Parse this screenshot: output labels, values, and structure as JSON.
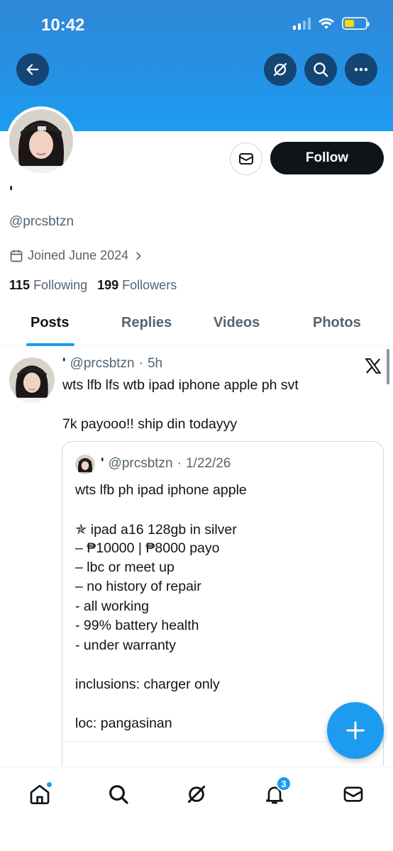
{
  "status_bar": {
    "time": "10:42"
  },
  "colors": {
    "accent": "#1d9bf0",
    "follow_bg": "#0f1419",
    "battery": "#ffd60a"
  },
  "header": {
    "back_icon": "arrow-left-icon",
    "grok_icon": "grok-icon",
    "search_icon": "search-icon",
    "more_icon": "more-icon"
  },
  "profile": {
    "display_name": "'",
    "handle": "@prcsbtzn",
    "joined": "Joined June 2024",
    "following_count": "115",
    "following_label": "Following",
    "followers_count": "199",
    "followers_label": "Followers",
    "follow_label": "Follow"
  },
  "tabs": [
    {
      "label": "Posts"
    },
    {
      "label": "Replies"
    },
    {
      "label": "Videos"
    },
    {
      "label": "Photos"
    }
  ],
  "post": {
    "name": "'",
    "handle": "@prcsbtzn",
    "sep": "·",
    "time": "5h",
    "text_line1": "wts lfb lfs wtb ipad iphone apple ph svt",
    "text_line2": "7k payooo!! ship din todayyy",
    "quote": {
      "name": "'",
      "handle": "@prcsbtzn",
      "sep": "·",
      "date": "1/22/26",
      "lines": [
        "wts lfb ph ipad iphone apple",
        "✯ ipad a16 128gb in silver",
        "– ₱10000 | ₱8000 payo",
        "– lbc or meet up",
        "– no history of repair",
        "- all working",
        "- 99% battery health",
        "- under warranty",
        "inclusions: charger only",
        "loc: pangasinan"
      ]
    }
  },
  "bottom_nav": {
    "items": [
      "home-icon",
      "search-icon",
      "grok-icon",
      "notifications-icon",
      "messages-icon"
    ],
    "notification_count": "3"
  }
}
